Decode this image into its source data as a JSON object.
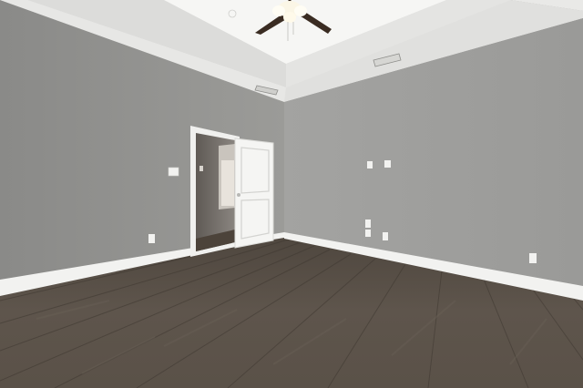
{
  "scene": {
    "kind": "empty-bedroom-interior",
    "colors": {
      "ceiling": "#f4f4f2",
      "tray_ceiling": "#eeeeec",
      "wall_left": "#8f8f8d",
      "wall_right": "#a7a7a5",
      "baseboard": "#f2f2f0",
      "floor": "#5d544b",
      "floor_dark": "#4a423a",
      "door": "#f5f5f3",
      "hallway": "#6e6a66",
      "fan_blade": "#3a2c22",
      "fan_light": "#fbf6e6"
    },
    "objects": [
      "ceiling-fan",
      "air-vent",
      "open-doorway",
      "interior-door",
      "light-switch",
      "electrical-outlet",
      "wood-plank-floor",
      "baseboard-trim"
    ]
  }
}
